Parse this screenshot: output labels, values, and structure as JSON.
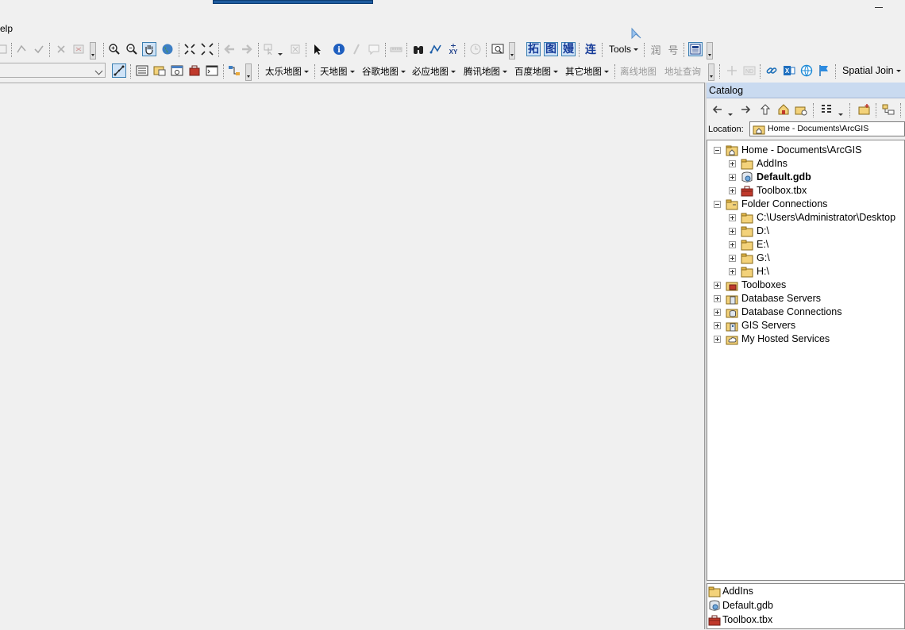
{
  "menu": {
    "help_partial": "elp"
  },
  "toolbar1": {
    "tools_label": "Tools",
    "cn_buttons": [
      "拓",
      "图",
      "嫚"
    ],
    "lian": "连",
    "runs": [
      "润",
      "号"
    ]
  },
  "toolbar2": {
    "basemaps": [
      "太乐地图",
      "天地图",
      "谷歌地图",
      "必应地图",
      "腾讯地图",
      "百度地图",
      "其它地图"
    ],
    "offline_map": "离线地图",
    "address_query": "地址查询",
    "spatial_join": "Spatial Join"
  },
  "catalog": {
    "title": "Catalog",
    "location_label": "Location:",
    "location_value": "Home - Documents\\ArcGIS",
    "tree": [
      {
        "label": "Home - Documents\\ArcGIS",
        "level": 0,
        "expanded": true,
        "icon": "home-folder-icon"
      },
      {
        "label": "AddIns",
        "level": 1,
        "expanded": false,
        "icon": "folder-icon"
      },
      {
        "label": "Default.gdb",
        "level": 1,
        "expanded": false,
        "icon": "geodatabase-icon",
        "bold": true
      },
      {
        "label": "Toolbox.tbx",
        "level": 1,
        "expanded": false,
        "icon": "toolbox-icon"
      },
      {
        "label": "Folder Connections",
        "level": 0,
        "expanded": true,
        "icon": "folder-connections-icon"
      },
      {
        "label": "C:\\Users\\Administrator\\Desktop",
        "level": 1,
        "expanded": false,
        "icon": "folder-icon"
      },
      {
        "label": "D:\\",
        "level": 1,
        "expanded": false,
        "icon": "folder-icon"
      },
      {
        "label": "E:\\",
        "level": 1,
        "expanded": false,
        "icon": "folder-icon"
      },
      {
        "label": "G:\\",
        "level": 1,
        "expanded": false,
        "icon": "folder-icon"
      },
      {
        "label": "H:\\",
        "level": 1,
        "expanded": false,
        "icon": "folder-icon"
      },
      {
        "label": "Toolboxes",
        "level": 0,
        "expanded": false,
        "icon": "toolboxes-icon"
      },
      {
        "label": "Database Servers",
        "level": 0,
        "expanded": false,
        "icon": "database-servers-icon"
      },
      {
        "label": "Database Connections",
        "level": 0,
        "expanded": false,
        "icon": "database-connections-icon"
      },
      {
        "label": "GIS Servers",
        "level": 0,
        "expanded": false,
        "icon": "gis-servers-icon"
      },
      {
        "label": "My Hosted Services",
        "level": 0,
        "expanded": false,
        "icon": "hosted-services-icon"
      }
    ],
    "contents": [
      {
        "label": "AddIns",
        "icon": "folder-icon"
      },
      {
        "label": "Default.gdb",
        "icon": "geodatabase-icon"
      },
      {
        "label": "Toolbox.tbx",
        "icon": "toolbox-icon"
      }
    ]
  },
  "colors": {
    "accent": "#3c7fb1",
    "catalog_header": "#c9daf0",
    "folder": "#e8c15a",
    "toolbox": "#c0392b"
  }
}
